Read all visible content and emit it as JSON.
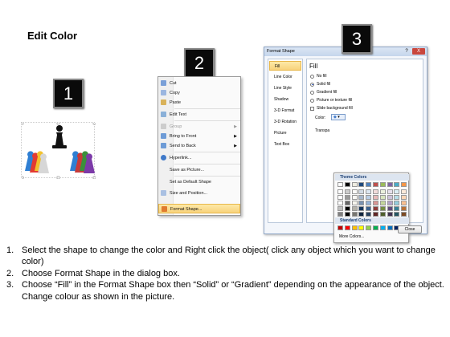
{
  "title": "Edit Color",
  "badges": [
    "1",
    "2",
    "3"
  ],
  "context_menu": {
    "items": [
      {
        "label": "Cut",
        "icon": "scissors-icon",
        "disabled": false
      },
      {
        "label": "Copy",
        "icon": "copy-icon",
        "disabled": false
      },
      {
        "label": "Paste",
        "icon": "paste-icon",
        "disabled": false
      },
      {
        "label": "Edit Text",
        "icon": "edit-text-icon",
        "disabled": false
      },
      {
        "label": "Group",
        "icon": "group-icon",
        "disabled": true
      },
      {
        "label": "Bring to Front",
        "icon": "bring-to-front-icon",
        "disabled": false
      },
      {
        "label": "Send to Back",
        "icon": "send-to-back-icon",
        "disabled": false
      },
      {
        "label": "Hyperlink...",
        "icon": "hyperlink-icon",
        "disabled": false
      },
      {
        "label": "Save as Picture...",
        "icon": "",
        "disabled": false
      },
      {
        "label": "Set as Default Shape",
        "icon": "",
        "disabled": false
      },
      {
        "label": "Size and Position...",
        "icon": "size-position-icon",
        "disabled": false
      },
      {
        "label": "Format Shape...",
        "icon": "format-shape-icon",
        "disabled": false
      }
    ]
  },
  "dialog": {
    "title": "Format Shape",
    "help_label": "?",
    "close_label": "X",
    "categories": [
      "Fill",
      "Line Color",
      "Line Style",
      "Shadow",
      "3-D Format",
      "3-D Rotation",
      "Picture",
      "Text Box"
    ],
    "fill_heading": "Fill",
    "options": [
      "No fill",
      "Solid fill",
      "Gradient fill",
      "Picture or texture fill"
    ],
    "slide_bg_label": "Slide background fill",
    "color_label": "Color:",
    "transparency_label": "Transpa",
    "theme_colors_label": "Theme Colors",
    "standard_colors_label": "Standard Colors",
    "more_colors_label": "More Colors...",
    "close_button": "Close"
  },
  "colors": {
    "theme_top": [
      "#ffffff",
      "#000000",
      "#eeece1",
      "#1f497d",
      "#4f81bd",
      "#c0504d",
      "#9bbb59",
      "#8064a2",
      "#4bacc6",
      "#f79646"
    ],
    "standard": [
      "#c00000",
      "#ff0000",
      "#ffc000",
      "#ffff00",
      "#92d050",
      "#00b050",
      "#00b0f0",
      "#0070c0",
      "#002060",
      "#7030a0"
    ],
    "highlight": "#f8d27b"
  },
  "instructions": [
    {
      "num": "1.",
      "text": "Select the shape to change the color and Right click the object( click any object which you want to change color)"
    },
    {
      "num": "2.",
      "text": "Choose Format Shape in the dialog box."
    },
    {
      "num": "3.",
      "text": "Choose “Fill” in the Format Shape box then “Solid” or “Gradient” depending on the appearance of the object. Change colour as shown in the picture."
    }
  ]
}
